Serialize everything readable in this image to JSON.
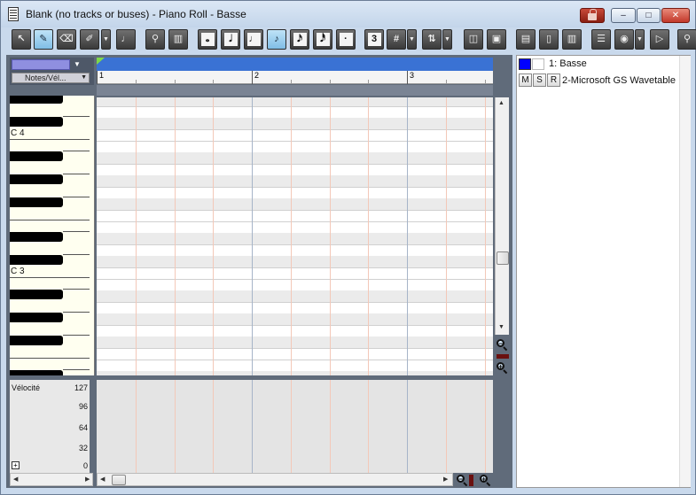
{
  "window": {
    "title": "Blank (no tracks or buses) - Piano Roll - Basse",
    "close_label": "✕",
    "minimize_label": "–",
    "maximize_label": "□"
  },
  "toolbar": {
    "buttons": [
      {
        "name": "select-tool",
        "icon": "arrow-select-icon",
        "glyph": "↖"
      },
      {
        "name": "draw-tool",
        "icon": "pencil-icon",
        "glyph": "✎",
        "active": true
      },
      {
        "name": "erase-tool",
        "icon": "eraser-icon",
        "glyph": "⌫"
      },
      {
        "name": "brush-tool",
        "icon": "brush-icon",
        "glyph": "✐"
      },
      {
        "name": "mute-tool",
        "icon": "mute-icon",
        "glyph": "♩"
      },
      {
        "name": "scrub-tool",
        "icon": "scrub-icon",
        "glyph": "⚲"
      },
      {
        "name": "keyboard-tool",
        "icon": "keyboard-icon",
        "glyph": "▥"
      }
    ],
    "note_durations": [
      {
        "name": "whole-note",
        "glyph": "𝅝"
      },
      {
        "name": "half-note",
        "glyph": "𝅗𝅥"
      },
      {
        "name": "quarter-note",
        "glyph": "♩"
      },
      {
        "name": "eighth-note",
        "glyph": "♪",
        "active": true
      },
      {
        "name": "sixteenth-note",
        "glyph": "𝅘𝅥𝅯"
      },
      {
        "name": "thirty-second-note",
        "glyph": "𝅘𝅥𝅰"
      },
      {
        "name": "dotted-modifier",
        "glyph": "·"
      },
      {
        "name": "triplet-modifier",
        "glyph": "3"
      }
    ],
    "snap_glyph": "#",
    "transpose_glyph": "⇅"
  },
  "controller_selector": {
    "label": "Notes/Vél..."
  },
  "ruler": {
    "measures": [
      "1",
      "2",
      "3"
    ]
  },
  "keyboard": {
    "labels": [
      "C 4",
      "C 3"
    ]
  },
  "velocity": {
    "title": "Vélocité",
    "ticks": [
      "127",
      "96",
      "64",
      "32",
      "0"
    ],
    "expand": "+"
  },
  "track": {
    "name": "1: Basse",
    "mute": "M",
    "solo": "S",
    "record": "R",
    "output": "2-Microsoft GS Wavetable",
    "color": "#0000ff"
  }
}
